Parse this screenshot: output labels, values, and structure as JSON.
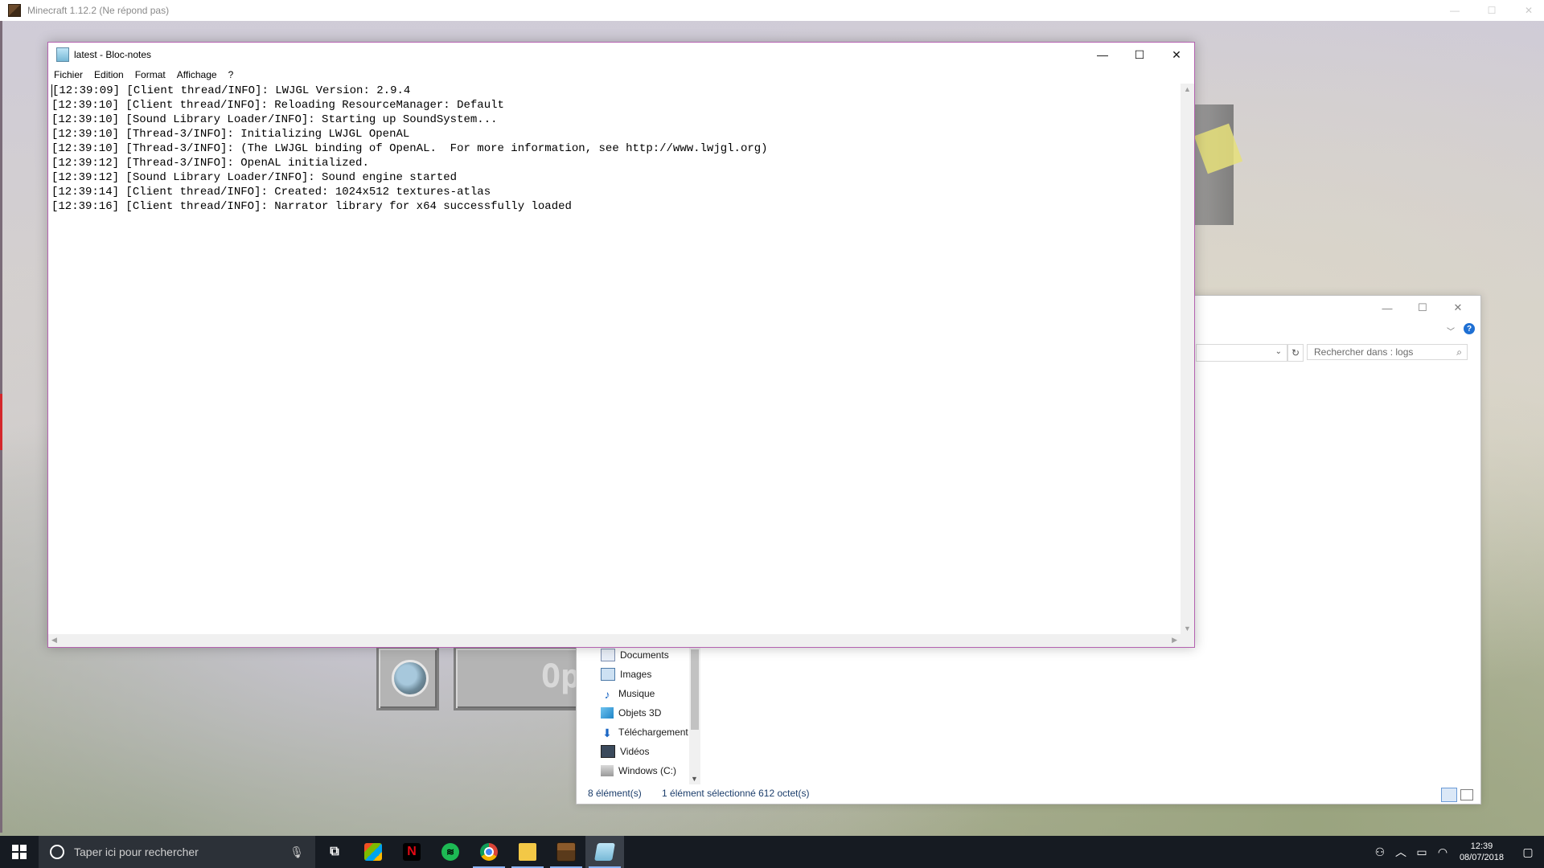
{
  "minecraft": {
    "title": "Minecraft 1.12.2 (Ne répond pas)",
    "options_partial": "Op"
  },
  "notepad": {
    "title": "latest - Bloc-notes",
    "menu": [
      "Fichier",
      "Edition",
      "Format",
      "Affichage",
      "?"
    ],
    "lines": [
      "[12:39:09] [Client thread/INFO]: LWJGL Version: 2.9.4",
      "[12:39:10] [Client thread/INFO]: Reloading ResourceManager: Default",
      "[12:39:10] [Sound Library Loader/INFO]: Starting up SoundSystem...",
      "[12:39:10] [Thread-3/INFO]: Initializing LWJGL OpenAL",
      "[12:39:10] [Thread-3/INFO]: (The LWJGL binding of OpenAL.  For more information, see http://www.lwjgl.org)",
      "[12:39:12] [Thread-3/INFO]: OpenAL initialized.",
      "[12:39:12] [Sound Library Loader/INFO]: Sound engine started",
      "[12:39:14] [Client thread/INFO]: Created: 1024x512 textures-atlas",
      "[12:39:16] [Client thread/INFO]: Narrator library for x64 successfully loaded"
    ]
  },
  "explorer": {
    "search_placeholder": "Rechercher dans : logs",
    "nav_items": [
      "Documents",
      "Images",
      "Musique",
      "Objets 3D",
      "Téléchargement",
      "Vidéos",
      "Windows (C:)"
    ],
    "status_count": "8 élément(s)",
    "status_selection": "1 élément sélectionné  612 octet(s)"
  },
  "taskbar": {
    "search_placeholder": "Taper ici pour rechercher",
    "time": "12:39",
    "date": "08/07/2018",
    "apps": [
      "task-view",
      "store",
      "netflix",
      "spotify",
      "chrome",
      "file-explorer",
      "minecraft",
      "notepad"
    ]
  },
  "colors": {
    "notepad_border": "#b462b0",
    "taskbar_bg": "#161b22",
    "help_blue": "#1e6fd3"
  }
}
